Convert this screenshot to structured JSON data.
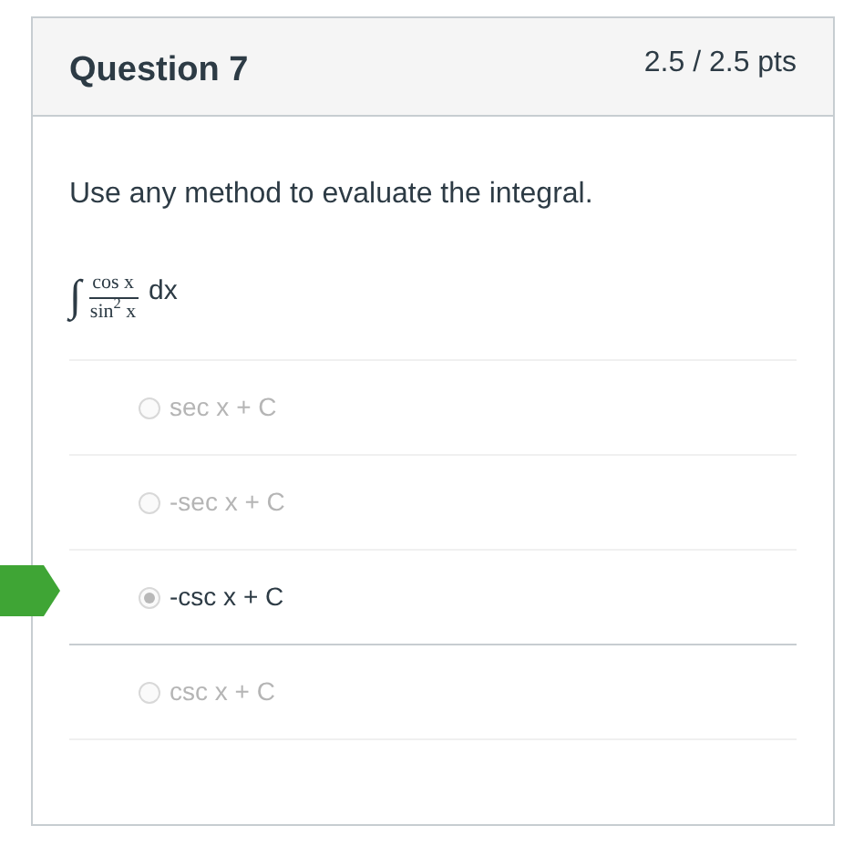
{
  "header": {
    "title": "Question 7",
    "points": "2.5 / 2.5 pts"
  },
  "prompt": "Use any method to evaluate the integral.",
  "formula": {
    "integral": "∫",
    "numerator": "cos x",
    "denominator": "sin$^{2}$ x",
    "differential": "dx"
  },
  "options": [
    {
      "label": "sec x + C",
      "selected": false,
      "correct": false
    },
    {
      "label": "-sec x + C",
      "selected": false,
      "correct": false
    },
    {
      "label": "-csc x + C",
      "selected": true,
      "correct": true
    },
    {
      "label": "csc x + C",
      "selected": false,
      "correct": false
    }
  ]
}
